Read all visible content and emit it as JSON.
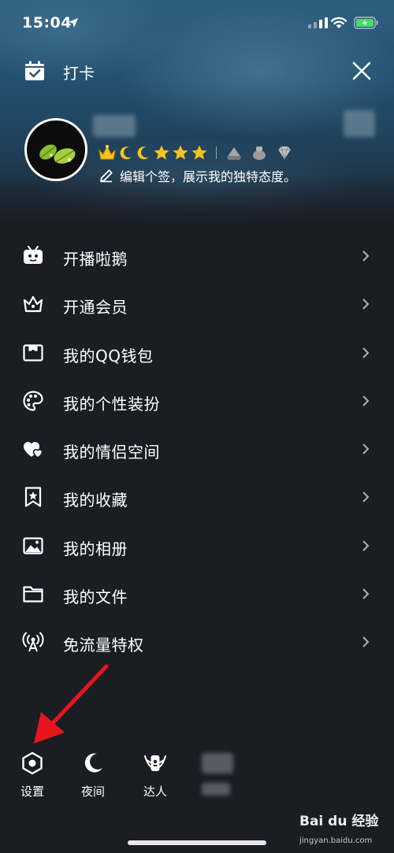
{
  "status_bar": {
    "time": "15:04"
  },
  "header": {
    "checkin_label": "打卡"
  },
  "profile": {
    "signature": "编辑个签，展示我的独特态度。"
  },
  "menu": {
    "items": [
      {
        "label": "开播啦鹅",
        "icon": "tv-robot-icon"
      },
      {
        "label": "开通会员",
        "icon": "crown-icon"
      },
      {
        "label": "我的QQ钱包",
        "icon": "wallet-icon"
      },
      {
        "label": "我的个性装扮",
        "icon": "palette-icon"
      },
      {
        "label": "我的情侣空间",
        "icon": "hearts-icon"
      },
      {
        "label": "我的收藏",
        "icon": "bookmark-star-icon"
      },
      {
        "label": "我的相册",
        "icon": "photo-icon"
      },
      {
        "label": "我的文件",
        "icon": "folder-icon"
      },
      {
        "label": "免流量特权",
        "icon": "antenna-icon"
      }
    ]
  },
  "bottom": {
    "settings_label": "设置",
    "night_label": "夜间",
    "expert_label": "达人"
  },
  "watermark": {
    "brand": "Bai du 经验",
    "url": "jingyan.baidu.com"
  },
  "colors": {
    "background": "#1b1d24",
    "text": "#ffffff",
    "annotation_arrow": "#e8141c"
  }
}
